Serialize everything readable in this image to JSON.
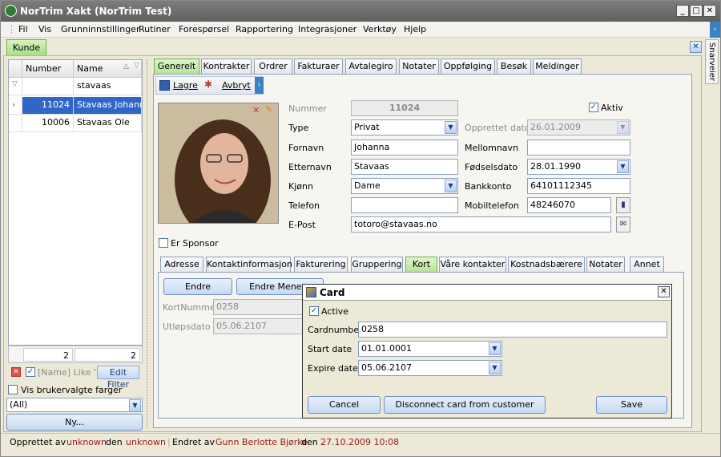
{
  "window": {
    "title": "NorTrim Xakt (NorTrim Test)"
  },
  "menu": [
    "Fil",
    "Vis",
    "Grunninnstillinger",
    "Rutiner",
    "Forespørsel",
    "Rapportering",
    "Integrasjoner",
    "Verktøy",
    "Hjelp"
  ],
  "main_tab": "Kunde",
  "side_tab": "Snarveier",
  "list": {
    "headers": {
      "number": "Number",
      "name": "Name"
    },
    "filter_value": "stavaas",
    "rows": [
      {
        "number": "11024",
        "name": "Stavaas Johanna"
      },
      {
        "number": "10006",
        "name": "Stavaas Ole"
      }
    ],
    "totals": {
      "count1": "2",
      "count2": "2"
    },
    "filter_text": "[Name] Like '...",
    "edit_filter": "Edit Filter",
    "vis_label": "Vis brukervalgte farger",
    "color_select": "(All)",
    "new_button": "Ny..."
  },
  "tabs": [
    "Generelt",
    "Kontrakter",
    "Ordrer",
    "Fakturaer",
    "Avtalegiro",
    "Notater",
    "Oppfølging",
    "Besøk",
    "Meldinger"
  ],
  "toolbar": {
    "save": "Lagre",
    "cancel": "Avbryt"
  },
  "form": {
    "labels": {
      "number": "Nummer",
      "type": "Type",
      "firstname": "Fornavn",
      "lastname": "Etternavn",
      "gender": "Kjønn",
      "phone": "Telefon",
      "email": "E-Post",
      "active": "Aktiv",
      "created": "Opprettet dato",
      "middlename": "Mellomnavn",
      "birthdate": "Fødselsdato",
      "bank": "Bankkonto",
      "mobile": "Mobiltelefon"
    },
    "values": {
      "number": "11024",
      "type": "Privat",
      "firstname": "Johanna",
      "lastname": "Stavaas",
      "gender": "Dame",
      "phone": "",
      "email": "totoro@stavaas.no",
      "created": "26.01.2009",
      "middlename": "",
      "birthdate": "28.01.1990",
      "bank": "64101112345",
      "mobile": "48246070"
    },
    "sponsor": "Er Sponsor"
  },
  "subtabs": [
    "Adresse",
    "Kontaktinformasjon",
    "Fakturering",
    "Gruppering",
    "Kort",
    "Våre kontakter",
    "Kostnadsbærere",
    "Notater",
    "Annet"
  ],
  "card_panel": {
    "btn_edit": "Endre",
    "btn_edit2": "Endre Menerg",
    "card_label": "KortNummer",
    "card_value": "0258",
    "expiry_label": "Utløpsdato",
    "expiry_value": "05.06.2107"
  },
  "dialog": {
    "title": "Card",
    "active": "Active",
    "cardnumber_label": "Cardnumber",
    "cardnumber_value": "0258",
    "start_label": "Start date",
    "start_value": "01.01.0001",
    "expire_label": "Expire date",
    "expire_value": "05.06.2107",
    "cancel": "Cancel",
    "disconnect": "Disconnect card from customer",
    "save": "Save"
  },
  "status": {
    "created_by_label": "Opprettet av",
    "created_by": "unknown",
    "created_on_label": "den",
    "created_on": "unknown",
    "changed_by_label": "Endret av",
    "changed_by": "Gunn Berlotte Bjørke",
    "changed_on_label": "den",
    "changed_on": "27.10.2009 10:08"
  }
}
